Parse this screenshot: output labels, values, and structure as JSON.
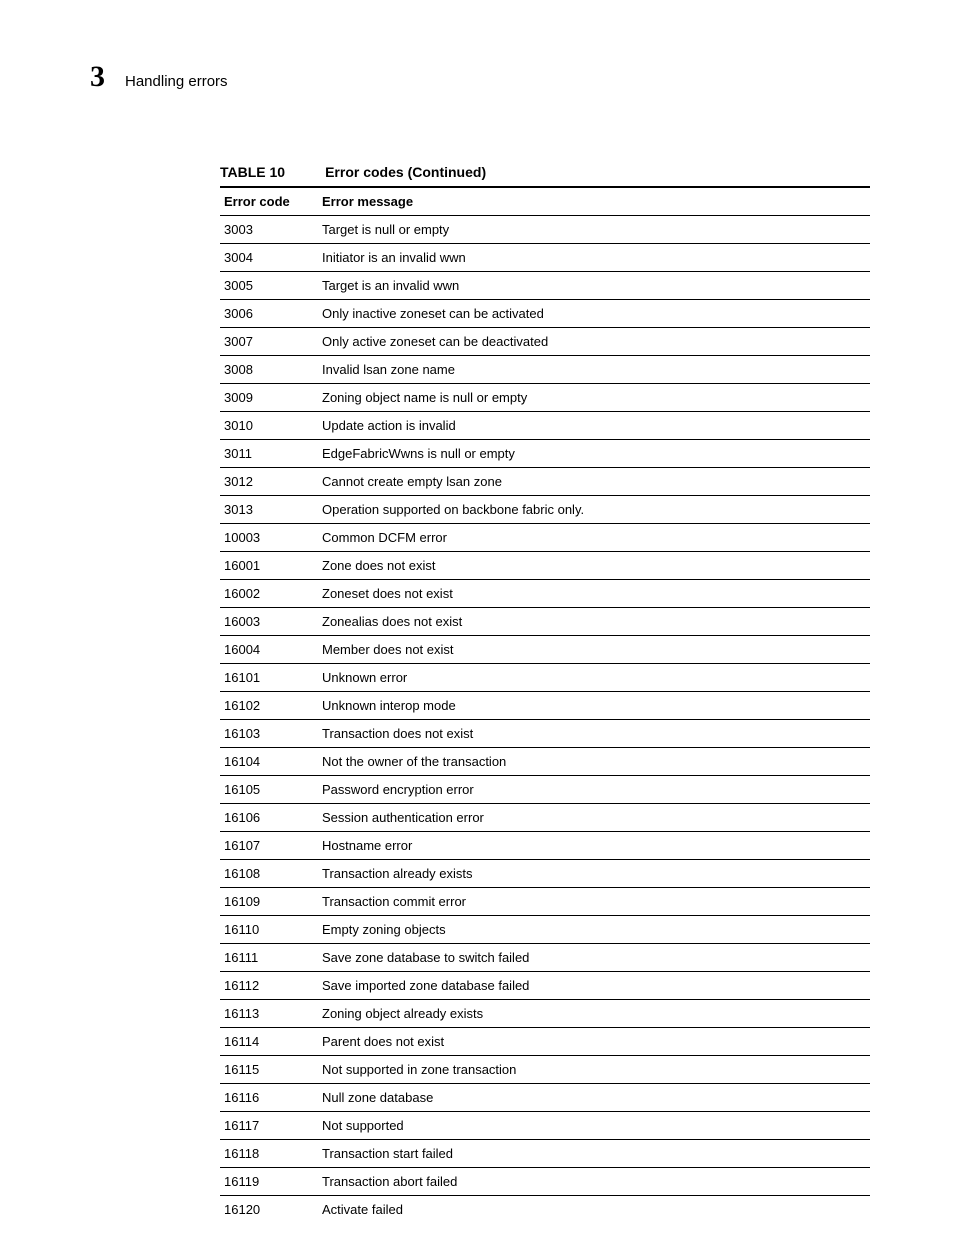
{
  "header": {
    "section_number": "3",
    "section_title": "Handling errors"
  },
  "table": {
    "label": "TABLE 10",
    "caption": "Error codes (Continued)",
    "columns": {
      "code": "Error code",
      "message": "Error message"
    },
    "rows": [
      {
        "code": "3003",
        "message": "Target is null or empty"
      },
      {
        "code": "3004",
        "message": "Initiator is an invalid wwn"
      },
      {
        "code": "3005",
        "message": "Target is an invalid wwn"
      },
      {
        "code": "3006",
        "message": "Only inactive zoneset can be activated"
      },
      {
        "code": "3007",
        "message": "Only active zoneset can be deactivated"
      },
      {
        "code": "3008",
        "message": "Invalid lsan zone name"
      },
      {
        "code": "3009",
        "message": "Zoning object name is null or empty"
      },
      {
        "code": "3010",
        "message": "Update action is invalid"
      },
      {
        "code": "3011",
        "message": "EdgeFabricWwns is null or empty"
      },
      {
        "code": "3012",
        "message": "Cannot create empty lsan zone"
      },
      {
        "code": "3013",
        "message": "Operation supported on backbone fabric only."
      },
      {
        "code": "10003",
        "message": "Common DCFM error"
      },
      {
        "code": "16001",
        "message": "Zone does not exist"
      },
      {
        "code": "16002",
        "message": "Zoneset does not exist"
      },
      {
        "code": "16003",
        "message": "Zonealias does not exist"
      },
      {
        "code": "16004",
        "message": "Member does not exist"
      },
      {
        "code": "16101",
        "message": "Unknown error"
      },
      {
        "code": "16102",
        "message": "Unknown interop mode"
      },
      {
        "code": "16103",
        "message": "Transaction does not exist"
      },
      {
        "code": "16104",
        "message": "Not the owner of the transaction"
      },
      {
        "code": "16105",
        "message": "Password encryption error"
      },
      {
        "code": "16106",
        "message": "Session authentication error"
      },
      {
        "code": "16107",
        "message": "Hostname error"
      },
      {
        "code": "16108",
        "message": "Transaction already exists"
      },
      {
        "code": "16109",
        "message": "Transaction commit error"
      },
      {
        "code": "16110",
        "message": "Empty zoning objects"
      },
      {
        "code": "16111",
        "message": "Save zone database to switch failed"
      },
      {
        "code": "16112",
        "message": "Save imported zone database failed"
      },
      {
        "code": "16113",
        "message": "Zoning object already exists"
      },
      {
        "code": "16114",
        "message": "Parent does not exist"
      },
      {
        "code": "16115",
        "message": "Not supported in zone transaction"
      },
      {
        "code": "16116",
        "message": "Null zone database"
      },
      {
        "code": "16117",
        "message": "Not supported"
      },
      {
        "code": "16118",
        "message": "Transaction start failed"
      },
      {
        "code": "16119",
        "message": "Transaction abort failed"
      },
      {
        "code": "16120",
        "message": "Activate failed"
      }
    ]
  }
}
